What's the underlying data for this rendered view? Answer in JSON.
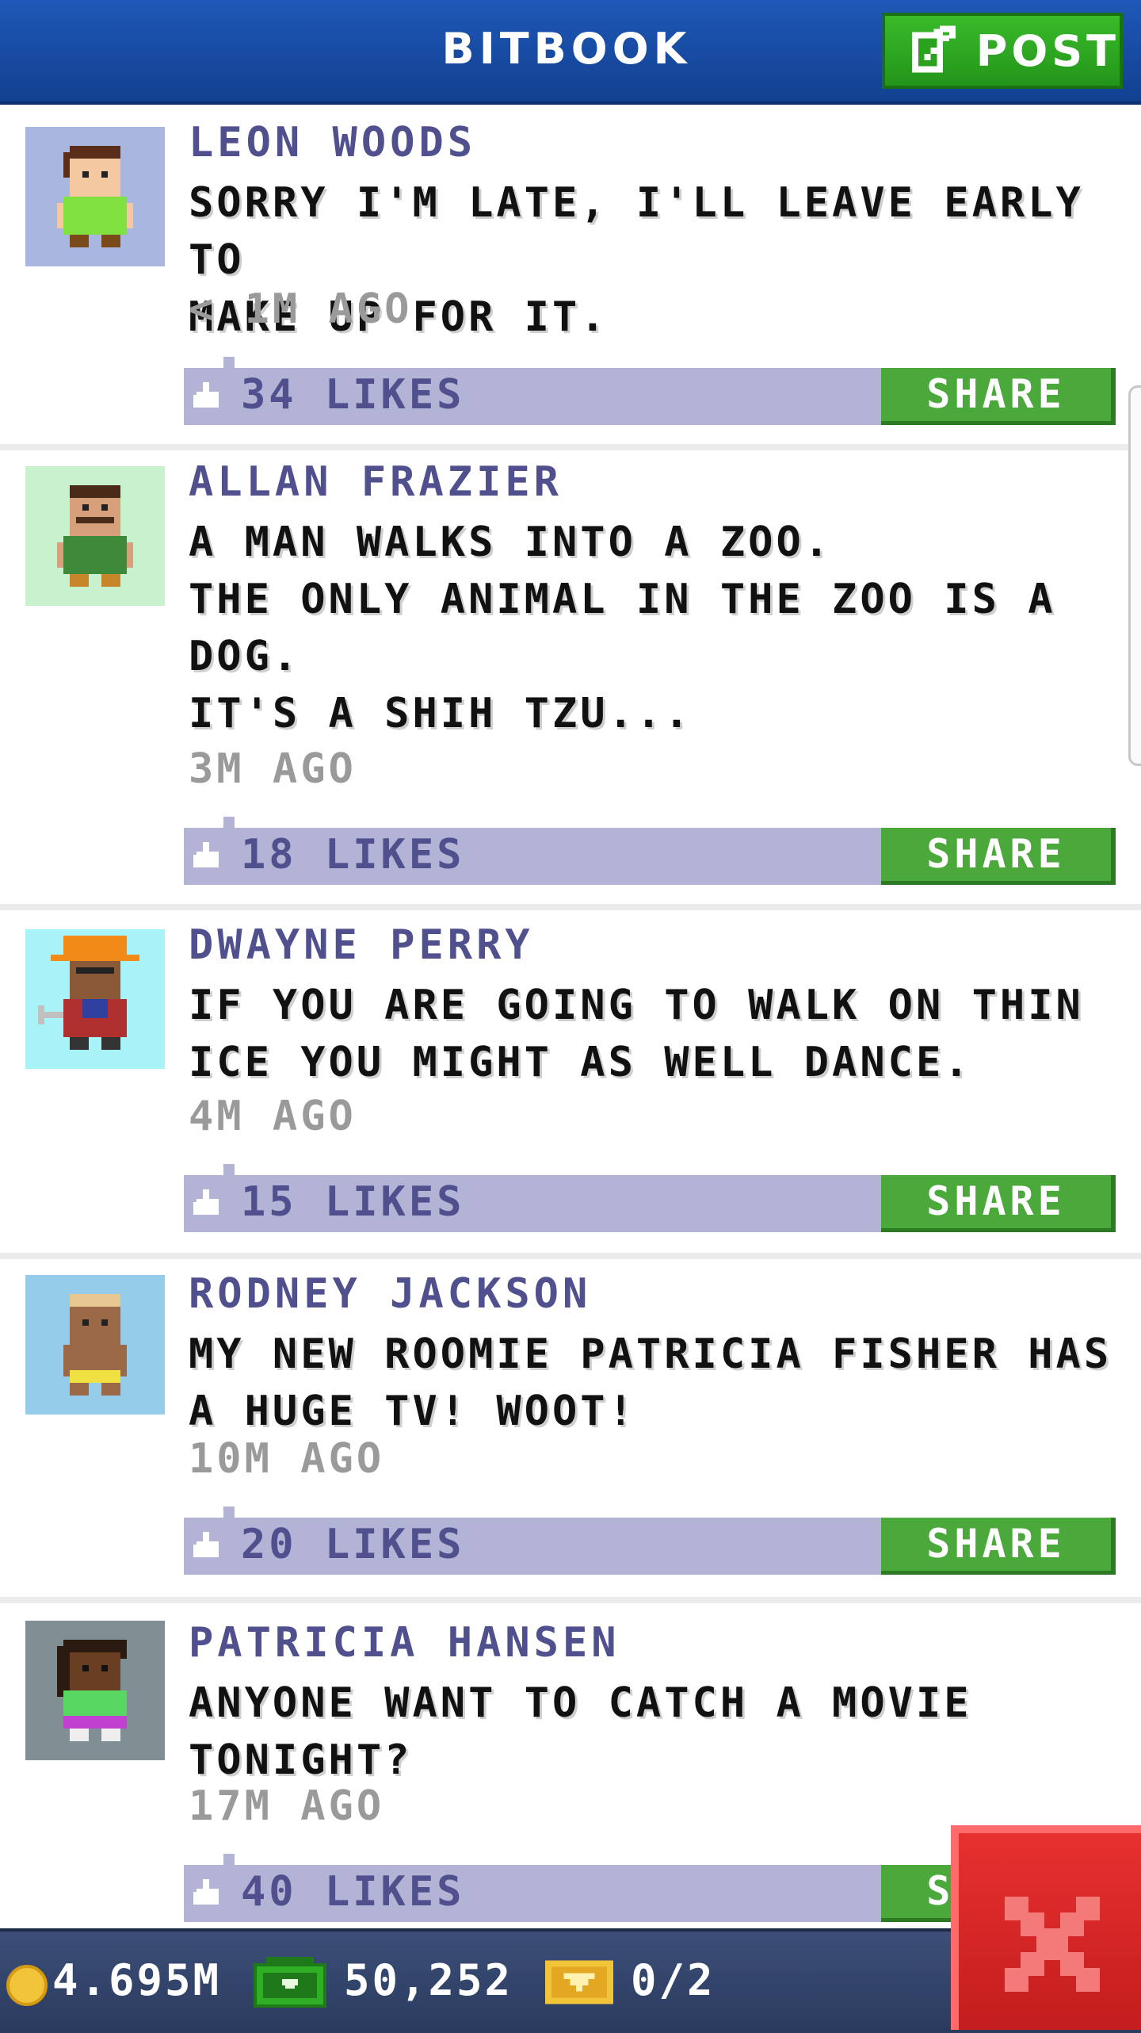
{
  "header": {
    "title": "BITBOOK",
    "post_label": "POST"
  },
  "posts": [
    {
      "name": "LEON WOODS",
      "message": "SORRY I'M LATE, I'LL LEAVE EARLY TO\nMAKE UP FOR IT.",
      "time": "< 1M AGO",
      "likes": "34 LIKES",
      "share": "SHARE",
      "avatar_bg": "#a9b6dd"
    },
    {
      "name": "ALLAN FRAZIER",
      "message": "A MAN WALKS INTO A ZOO.\nTHE ONLY ANIMAL IN THE ZOO IS A\nDOG.\nIT'S A SHIH TZU...",
      "time": "3M AGO",
      "likes": "18 LIKES",
      "share": "SHARE",
      "avatar_bg": "#c7f2cd"
    },
    {
      "name": "DWAYNE PERRY",
      "message": "IF YOU ARE GOING TO WALK ON THIN\nICE YOU MIGHT AS WELL DANCE.",
      "time": "4M AGO",
      "likes": "15 LIKES",
      "share": "SHARE",
      "avatar_bg": "#a8f3f7"
    },
    {
      "name": "RODNEY JACKSON",
      "message": "MY NEW ROOMIE PATRICIA FISHER HAS\nA HUGE TV! WOOT!",
      "time": "10M AGO",
      "likes": "20 LIKES",
      "share": "SHARE",
      "avatar_bg": "#94cce9"
    },
    {
      "name": "PATRICIA HANSEN",
      "message": "ANYONE WANT TO CATCH A MOVIE\nTONIGHT?",
      "time": "17M AGO",
      "likes": "40 LIKES",
      "share": "SHARE",
      "avatar_bg": "#7f8f93"
    }
  ],
  "bottom_bar": {
    "coins": "4.695M",
    "bux": "50,252",
    "tickets": "0/2"
  },
  "colors": {
    "header_blue": "#1a4fa8",
    "post_green": "#2fa822",
    "name_purple": "#50508e",
    "like_bar": "#b2b3d5",
    "share_green": "#4ba83b",
    "close_red": "#d82828"
  }
}
